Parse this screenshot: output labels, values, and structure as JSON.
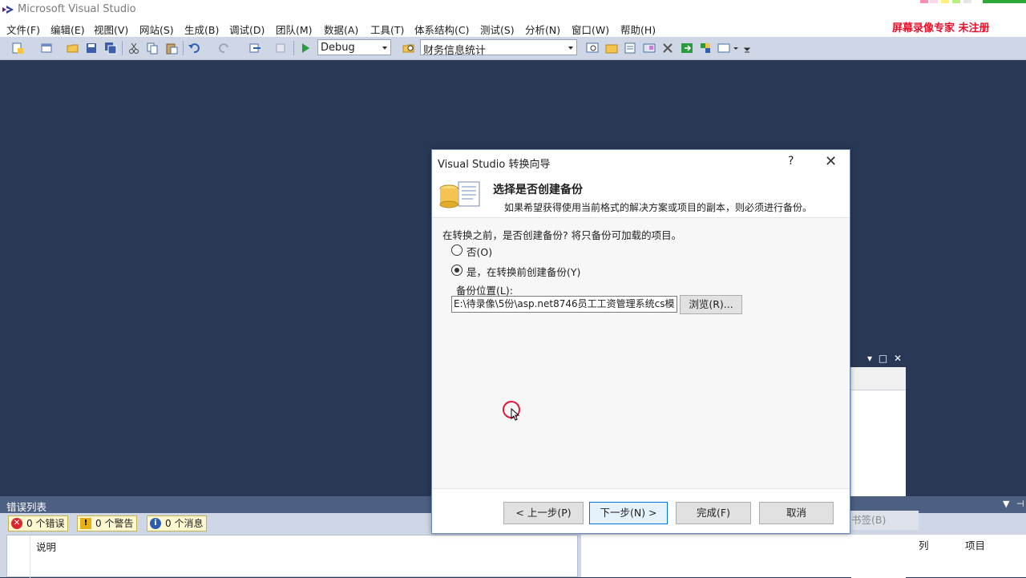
{
  "app": {
    "title": "Microsoft Visual Studio",
    "watermark": "屏幕录像专家  未注册"
  },
  "menu": [
    "文件(F)",
    "编辑(E)",
    "视图(V)",
    "网站(S)",
    "生成(B)",
    "调试(D)",
    "团队(M)",
    "数据(A)",
    "工具(T)",
    "体系结构(C)",
    "测试(S)",
    "分析(N)",
    "窗口(W)",
    "帮助(H)"
  ],
  "toolbar": {
    "config": "Debug",
    "project": "财务信息统计"
  },
  "dialog": {
    "title": "Visual Studio 转换向导",
    "help": "?",
    "close": "✕",
    "heading": "选择是否创建备份",
    "subheading": "如果希望获得使用当前格式的解决方案或项目的副本，则必须进行备份。",
    "question": "在转换之前，是否创建备份? 将只备份可加载的项目。",
    "option_no": "否(O)",
    "option_yes": "是，在转换前创建备份(Y)",
    "selected": "yes",
    "location_label": "备份位置(L):",
    "location_value": "E:\\待录像\\5份\\asp.net8746员工工资管理系统cs模",
    "browse": "浏览(R)...",
    "btn_prev": "< 上一步(P)",
    "btn_next": "下一步(N) >",
    "btn_finish": "完成(F)",
    "btn_cancel": "取消"
  },
  "error_list": {
    "title": "错误列表",
    "errors": "0 个错误",
    "warnings": "0 个警告",
    "messages": "0 个消息",
    "col_description": "说明",
    "bookmark_tab": "书签(B)",
    "col_column": "列",
    "col_project": "项目"
  }
}
